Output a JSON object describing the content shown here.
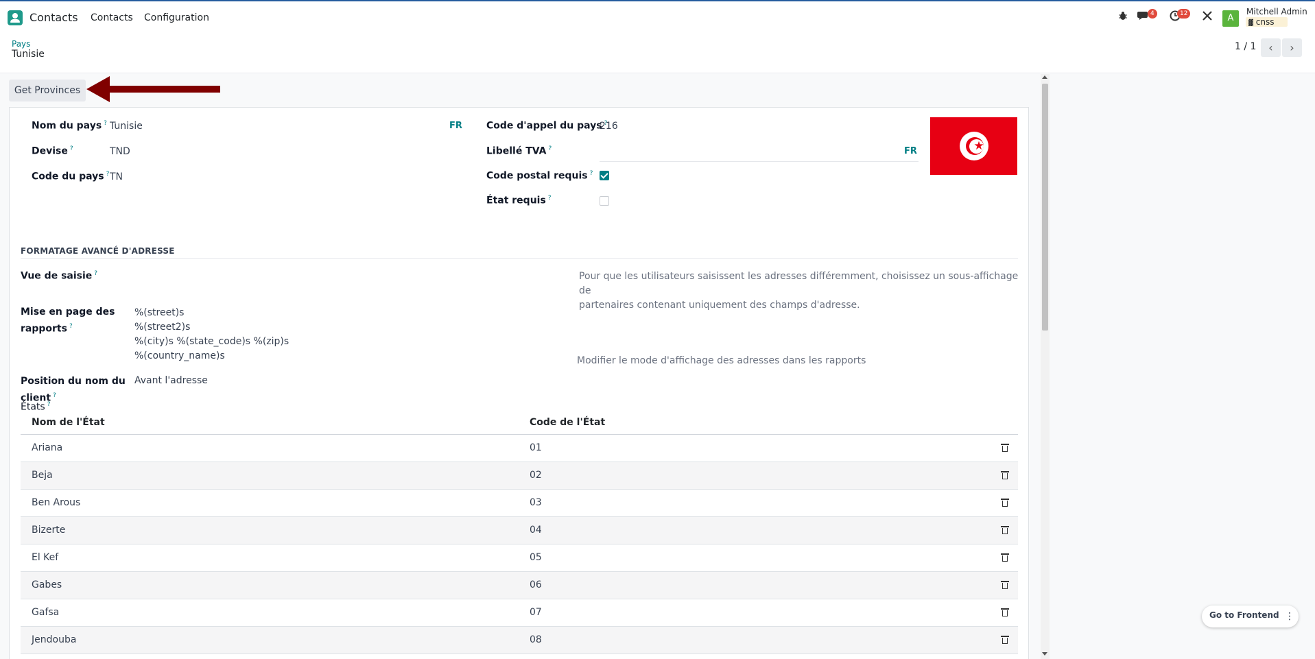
{
  "navbar": {
    "app_name": "Contacts",
    "menu": [
      "Contacts",
      "Configuration"
    ],
    "chat_badge": "4",
    "activity_badge": "12",
    "avatar_letter": "A",
    "user_name": "Mitchell Admin",
    "db_name": "cnss"
  },
  "breadcrumb": {
    "parent": "Pays",
    "current": "Tunisie"
  },
  "pager": {
    "value": "1 / 1"
  },
  "action": {
    "get_provinces": "Get Provinces"
  },
  "form": {
    "nom_du_pays": {
      "label": "Nom du pays",
      "value": "Tunisie",
      "lang": "FR"
    },
    "devise": {
      "label": "Devise",
      "value": "TND"
    },
    "code_du_pays": {
      "label": "Code du pays",
      "value": "TN"
    },
    "code_appel": {
      "label": "Code d'appel du pays",
      "value": "216"
    },
    "libelle_tva": {
      "label": "Libellé TVA",
      "value": "",
      "lang": "FR"
    },
    "code_postal_requis": {
      "label": "Code postal requis",
      "checked": true
    },
    "etat_requis": {
      "label": "État requis",
      "checked": false
    },
    "help_mark": "?"
  },
  "address": {
    "section_title": "FORMATAGE AVANCÉ D'ADRESSE",
    "vue_saisie_label": "Vue de saisie",
    "vue_saisie_help_1": "Pour que les utilisateurs saisissent les adresses différemment, choisissez un sous-affichage de",
    "vue_saisie_help_2": "partenaires contenant uniquement des champs d'adresse.",
    "mise_en_page_label_1": "Mise en page des",
    "mise_en_page_label_2": "rapports",
    "mise_en_page_lines": [
      "%(street)s",
      "%(street2)s",
      "%(city)s %(state_code)s %(zip)s",
      "%(country_name)s"
    ],
    "mise_en_page_help": "Modifier le mode d'affichage des adresses dans les rapports",
    "position_label_1": "Position du nom du",
    "position_label_2": "client",
    "position_value": "Avant l'adresse",
    "etats_label": "États"
  },
  "states_table": {
    "headers": [
      "Nom de l'État",
      "Code de l'État"
    ],
    "rows": [
      {
        "name": "Ariana",
        "code": "01"
      },
      {
        "name": "Beja",
        "code": "02"
      },
      {
        "name": "Ben Arous",
        "code": "03"
      },
      {
        "name": "Bizerte",
        "code": "04"
      },
      {
        "name": "El Kef",
        "code": "05"
      },
      {
        "name": "Gabes",
        "code": "06"
      },
      {
        "name": "Gafsa",
        "code": "07"
      },
      {
        "name": "Jendouba",
        "code": "08"
      }
    ]
  },
  "frontend": {
    "label": "Go to Frontend"
  },
  "colors": {
    "accent": "#017e84",
    "flag_red": "#e70013",
    "arrow": "#800000",
    "badge": "#e0493b"
  }
}
